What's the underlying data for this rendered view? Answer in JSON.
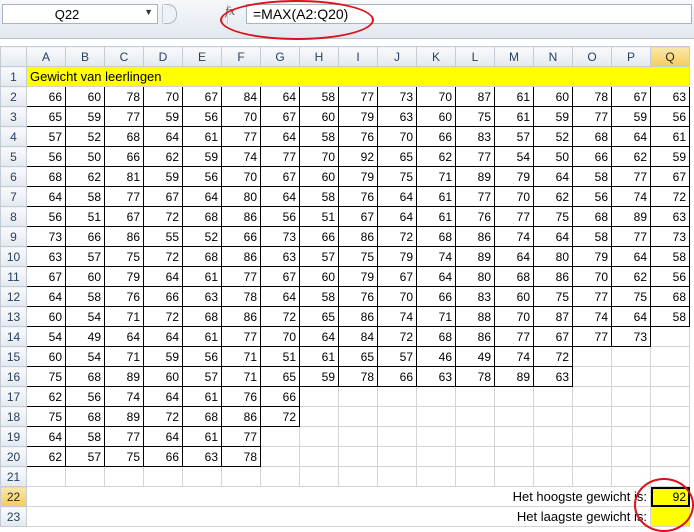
{
  "name_box": "Q22",
  "fx_label": "fx",
  "formula": "=MAX(A2:Q20)",
  "columns": [
    "A",
    "B",
    "C",
    "D",
    "E",
    "F",
    "G",
    "H",
    "I",
    "J",
    "K",
    "L",
    "M",
    "N",
    "O",
    "P",
    "Q"
  ],
  "selected_column": "Q",
  "title": "Gewicht van leerlingen",
  "rows": [
    [
      66,
      60,
      78,
      70,
      67,
      84,
      64,
      58,
      77,
      73,
      70,
      87,
      61,
      60,
      78,
      67,
      63
    ],
    [
      65,
      59,
      77,
      59,
      56,
      70,
      67,
      60,
      79,
      63,
      60,
      75,
      61,
      59,
      77,
      59,
      56
    ],
    [
      57,
      52,
      68,
      64,
      61,
      77,
      64,
      58,
      76,
      70,
      66,
      83,
      57,
      52,
      68,
      64,
      61
    ],
    [
      56,
      50,
      66,
      62,
      59,
      74,
      77,
      70,
      92,
      65,
      62,
      77,
      54,
      50,
      66,
      62,
      59
    ],
    [
      68,
      62,
      81,
      59,
      56,
      70,
      67,
      60,
      79,
      75,
      71,
      89,
      79,
      64,
      58,
      77,
      67
    ],
    [
      64,
      58,
      77,
      67,
      64,
      80,
      64,
      58,
      76,
      64,
      61,
      77,
      70,
      62,
      56,
      74,
      72
    ],
    [
      56,
      51,
      67,
      72,
      68,
      86,
      56,
      51,
      67,
      64,
      61,
      76,
      77,
      75,
      68,
      89,
      63
    ],
    [
      73,
      66,
      86,
      55,
      52,
      66,
      73,
      66,
      86,
      72,
      68,
      86,
      74,
      64,
      58,
      77,
      73
    ],
    [
      63,
      57,
      75,
      72,
      68,
      86,
      63,
      57,
      75,
      79,
      74,
      89,
      64,
      80,
      79,
      64,
      58
    ],
    [
      67,
      60,
      79,
      64,
      61,
      77,
      67,
      60,
      79,
      67,
      64,
      80,
      68,
      86,
      70,
      62,
      56
    ],
    [
      64,
      58,
      76,
      66,
      63,
      78,
      64,
      58,
      76,
      70,
      66,
      83,
      60,
      75,
      77,
      75,
      68
    ],
    [
      60,
      54,
      71,
      72,
      68,
      86,
      72,
      65,
      86,
      74,
      71,
      88,
      70,
      87,
      74,
      64,
      58
    ],
    [
      54,
      49,
      64,
      64,
      61,
      77,
      70,
      64,
      84,
      72,
      68,
      86,
      77,
      67,
      77,
      73,
      null
    ],
    [
      60,
      54,
      71,
      59,
      56,
      71,
      51,
      61,
      65,
      57,
      46,
      49,
      74,
      72,
      null,
      null,
      null
    ],
    [
      75,
      68,
      89,
      60,
      57,
      71,
      65,
      59,
      78,
      66,
      63,
      78,
      89,
      63,
      null,
      null,
      null
    ],
    [
      62,
      56,
      74,
      64,
      61,
      76,
      66,
      null,
      null,
      null,
      null,
      null,
      null,
      null,
      null,
      null,
      null
    ],
    [
      75,
      68,
      89,
      72,
      68,
      86,
      72,
      null,
      null,
      null,
      null,
      null,
      null,
      null,
      null,
      null,
      null
    ],
    [
      64,
      58,
      77,
      64,
      61,
      77,
      null,
      null,
      null,
      null,
      null,
      null,
      null,
      null,
      null,
      null,
      null
    ],
    [
      62,
      57,
      75,
      66,
      63,
      78,
      null,
      null,
      null,
      null,
      null,
      null,
      null,
      null,
      null,
      null,
      null
    ]
  ],
  "summary": {
    "max_label": "Het hoogste gewicht is:",
    "max_value": "92",
    "min_label": "Het laagste gewicht is:",
    "min_value": ""
  },
  "colors": {
    "highlight": "#ffff00",
    "annotation": "#d9121b"
  }
}
